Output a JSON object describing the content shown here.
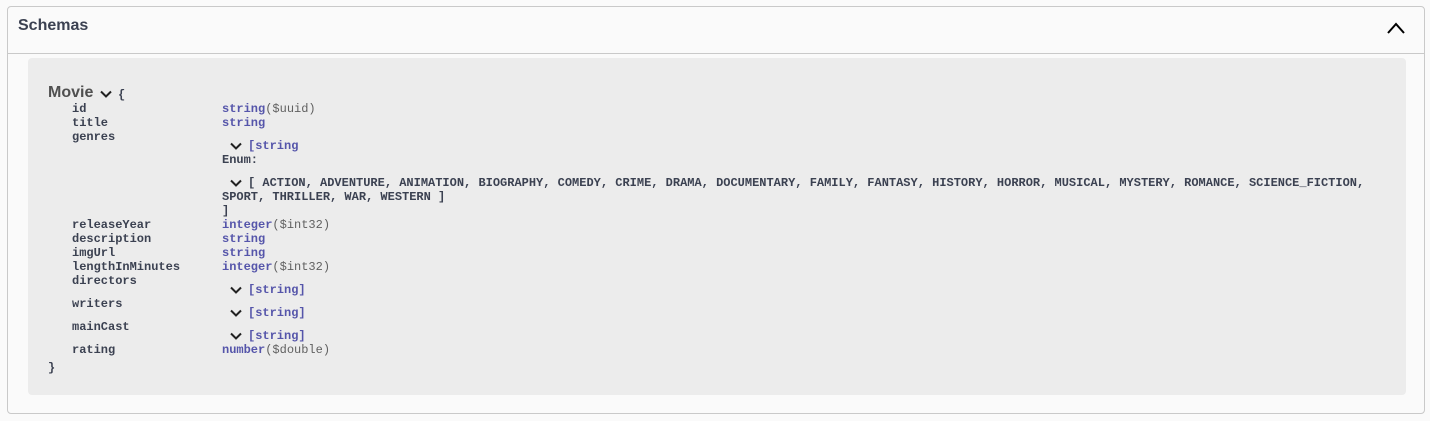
{
  "section": {
    "title": "Schemas"
  },
  "model": {
    "name": "Movie",
    "open_brace": "{",
    "close_brace": "}",
    "properties": [
      {
        "name": "id",
        "type": "string",
        "format": "($uuid)"
      },
      {
        "name": "title",
        "type": "string"
      },
      {
        "name": "genres",
        "type": "[string",
        "enum_label": "Enum:",
        "enum_values_line1": "[ ACTION, ADVENTURE, ANIMATION, BIOGRAPHY, COMEDY, CRIME, DRAMA, DOCUMENTARY, FAMILY, FANTASY, HISTORY, HORROR, MUSICAL, MYSTERY, ROMANCE, SCIENCE_FICTION,",
        "enum_values_line2": "SPORT, THRILLER, WAR, WESTERN ]",
        "close_bracket": "]"
      },
      {
        "name": "releaseYear",
        "type": "integer",
        "format": "($int32)"
      },
      {
        "name": "description",
        "type": "string"
      },
      {
        "name": "imgUrl",
        "type": "string"
      },
      {
        "name": "lengthInMinutes",
        "type": "integer",
        "format": "($int32)"
      },
      {
        "name": "directors",
        "type": "[string]"
      },
      {
        "name": "writers",
        "type": "[string]"
      },
      {
        "name": "mainCast",
        "type": "[string]"
      },
      {
        "name": "rating",
        "type": "number",
        "format": "($double)"
      }
    ]
  },
  "icons": {
    "collapse": "chevron-up-icon",
    "expand": "chevron-down-icon"
  }
}
